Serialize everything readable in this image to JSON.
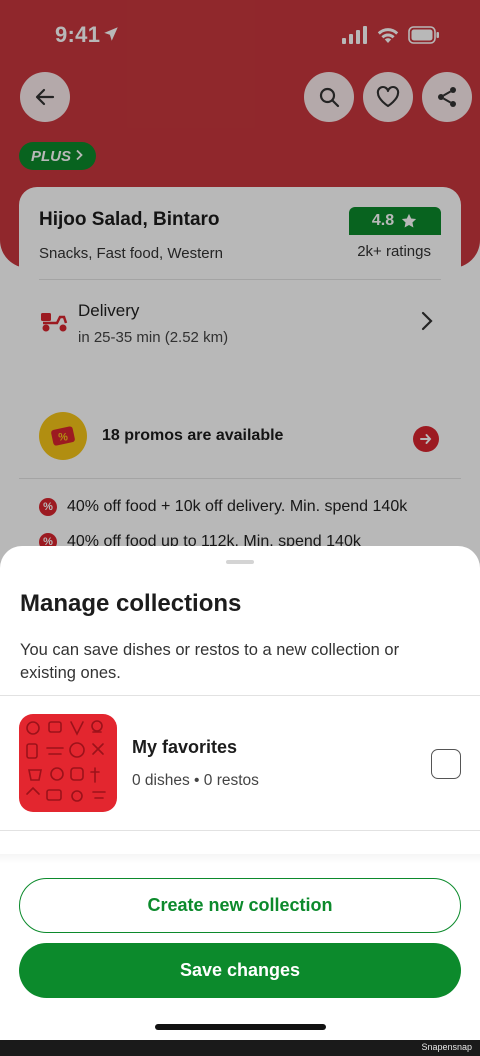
{
  "status_bar": {
    "time": "9:41"
  },
  "restaurant": {
    "plus_label": "PLUS",
    "name": "Hijoo Salad, Bintaro",
    "categories": "Snacks, Fast food, Western",
    "rating": "4.8",
    "ratings_count": "2k+ ratings"
  },
  "delivery": {
    "title": "Delivery",
    "subtitle": "in 25-35 min (2.52 km)"
  },
  "promos": {
    "title": "18 promos are available",
    "items": [
      "40% off food + 10k off delivery. Min. spend 140k",
      "40% off food up to 112k. Min. spend 140k"
    ]
  },
  "sheet": {
    "title": "Manage collections",
    "description": "You can save dishes or restos to a new collection or existing ones.",
    "collections": [
      {
        "name": "My favorites",
        "meta": "0 dishes • 0 restos",
        "checked": false
      }
    ],
    "create_button": "Create new collection",
    "save_button": "Save changes"
  },
  "watermark": "Snapensnap",
  "colors": {
    "brand_red": "#c8373d",
    "brand_green": "#0c8a2c",
    "promo_red": "#d9252e"
  }
}
